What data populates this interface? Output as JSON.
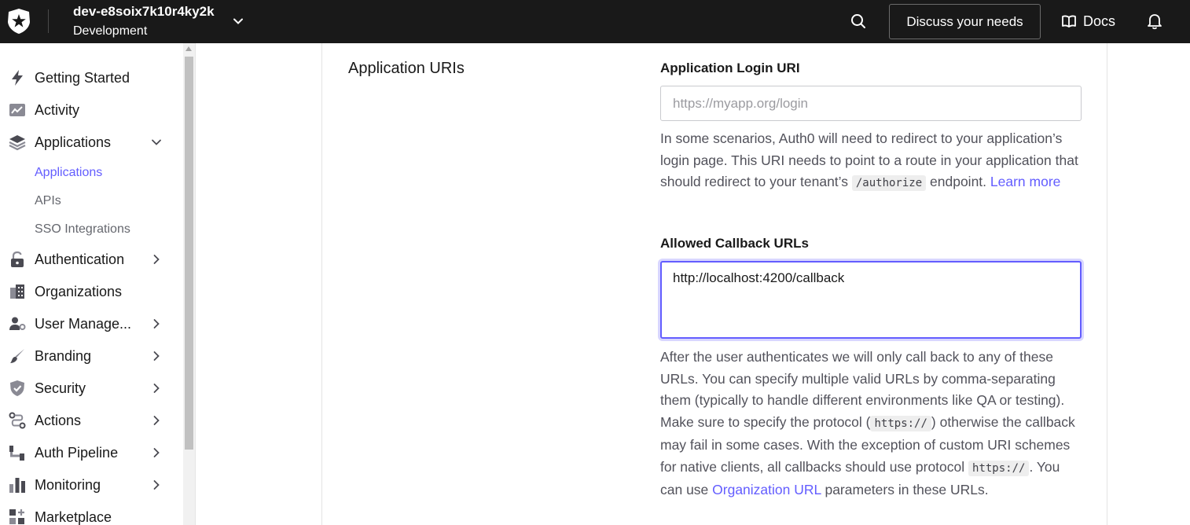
{
  "header": {
    "tenant_name": "dev-e8soix7k10r4ky2k",
    "tenant_env": "Development",
    "discuss_label": "Discuss your needs",
    "docs_label": "Docs"
  },
  "sidebar": {
    "items": [
      {
        "label": "Getting Started",
        "icon": "bolt-icon"
      },
      {
        "label": "Activity",
        "icon": "trend-chart-icon"
      },
      {
        "label": "Applications",
        "icon": "layers-icon",
        "expanded": true
      },
      {
        "label": "Authentication",
        "icon": "lock-icon"
      },
      {
        "label": "Organizations",
        "icon": "building-icon"
      },
      {
        "label": "User Manage...",
        "icon": "user-gear-icon"
      },
      {
        "label": "Branding",
        "icon": "brush-icon"
      },
      {
        "label": "Security",
        "icon": "shield-icon"
      },
      {
        "label": "Actions",
        "icon": "flow-icon"
      },
      {
        "label": "Auth Pipeline",
        "icon": "pipeline-icon"
      },
      {
        "label": "Monitoring",
        "icon": "bar-chart-icon"
      },
      {
        "label": "Marketplace",
        "icon": "grid-plus-icon"
      }
    ],
    "subitems": [
      {
        "label": "Applications",
        "active": true
      },
      {
        "label": "APIs",
        "active": false
      },
      {
        "label": "SSO Integrations",
        "active": false
      }
    ]
  },
  "main": {
    "section_title": "Application URIs",
    "login_uri": {
      "label": "Application Login URI",
      "placeholder": "https://myapp.org/login",
      "value": "",
      "help_text_1": "In some scenarios, Auth0 will need to redirect to your application’s login page. This URI needs to point to a route in your application that should redirect to your tenant’s ",
      "help_code": "/authorize",
      "help_text_2": " endpoint. ",
      "help_link": "Learn more"
    },
    "callback_urls": {
      "label": "Allowed Callback URLs",
      "value": "http://localhost:4200/callback",
      "help_text_1": "After the user authenticates we will only call back to any of these URLs. You can specify multiple valid URLs by comma-separating them (typically to handle different environments like QA or testing). Make sure to specify the protocol (",
      "help_code_1": "https://",
      "help_text_2": ") otherwise the callback may fail in some cases. With the exception of custom URI schemes for native clients, all callbacks should use protocol ",
      "help_code_2": "https://",
      "help_text_3": ". You can use ",
      "help_link": "Organization URL",
      "help_text_4": " parameters in these URLs."
    }
  },
  "colors": {
    "topbar": "#191919",
    "accent": "#635dff",
    "help_text": "#52525b"
  }
}
